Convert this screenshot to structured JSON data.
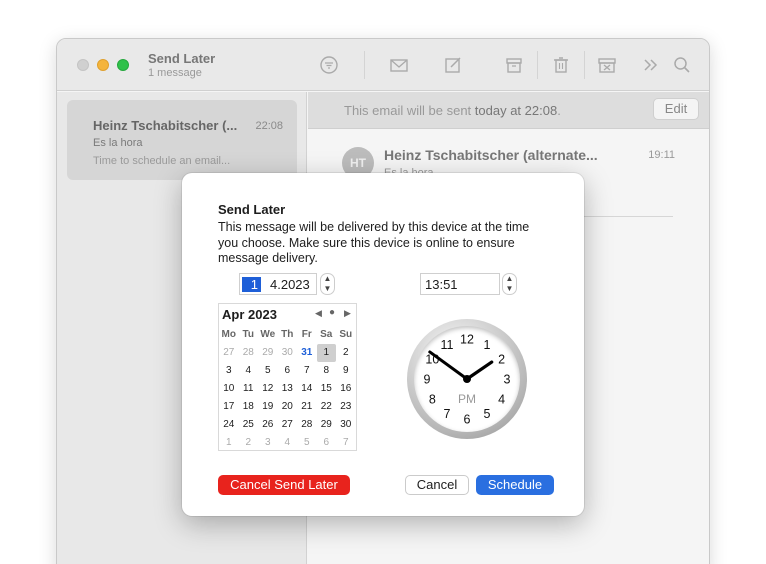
{
  "window": {
    "title": "Send Later",
    "subtitle": "1 message",
    "toolbar_icons": [
      "filter-icon",
      "envelope-icon",
      "compose-icon",
      "archive-icon",
      "trash-icon",
      "junk-icon",
      "more-chevron-icon",
      "search-icon"
    ]
  },
  "message_list": {
    "items": [
      {
        "from": "Heinz Tschabitscher (...",
        "time": "22:08",
        "subject": "Es la hora",
        "preview": "Time to schedule an email..."
      }
    ]
  },
  "banner": {
    "prefix": "This email will be sent ",
    "when": "today at 22:08",
    "suffix": ".",
    "edit_label": "Edit"
  },
  "message": {
    "avatar": "HT",
    "from": "Heinz Tschabitscher (alternate...",
    "time": "19:11",
    "subject": "Es la hora"
  },
  "dialog": {
    "title": "Send Later",
    "body": "This message will be delivered by this device at the time you choose. Make sure this device is online to ensure message delivery.",
    "date_day": "1",
    "date_rest": "4.2023",
    "time": "13:51",
    "calendar": {
      "month_label": "Apr 2023",
      "weekdays": [
        "Mo",
        "Tu",
        "We",
        "Th",
        "Fr",
        "Sa",
        "Su"
      ],
      "weeks": [
        [
          "27",
          "28",
          "29",
          "30",
          "31",
          "1",
          "2"
        ],
        [
          "3",
          "4",
          "5",
          "6",
          "7",
          "8",
          "9"
        ],
        [
          "10",
          "11",
          "12",
          "13",
          "14",
          "15",
          "16"
        ],
        [
          "17",
          "18",
          "19",
          "20",
          "21",
          "22",
          "23"
        ],
        [
          "24",
          "25",
          "26",
          "27",
          "28",
          "29",
          "30"
        ],
        [
          "1",
          "2",
          "3",
          "4",
          "5",
          "6",
          "7"
        ]
      ],
      "selected_day": "1"
    },
    "clock": {
      "hour": 13,
      "minute": 51,
      "meridiem": "PM",
      "numbers": [
        "12",
        "1",
        "2",
        "3",
        "4",
        "5",
        "6",
        "7",
        "8",
        "9",
        "10",
        "11"
      ]
    },
    "cancel_send_later_label": "Cancel Send Later",
    "cancel_label": "Cancel",
    "schedule_label": "Schedule"
  },
  "colors": {
    "accent": "#2a6fe0",
    "destructive": "#e8231d",
    "selected_date": "#1e5fd8"
  }
}
